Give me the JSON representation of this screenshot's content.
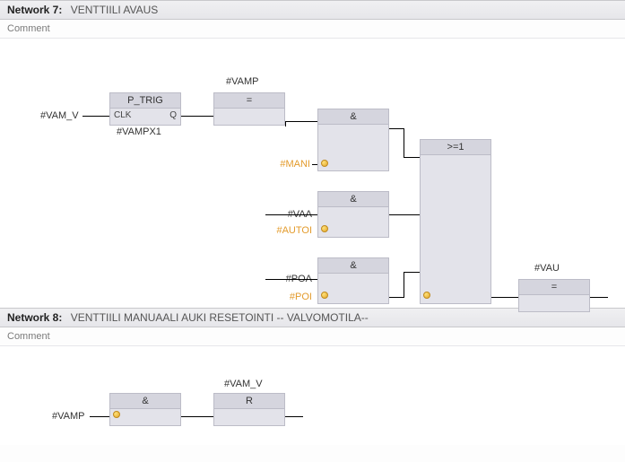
{
  "network7": {
    "label": "Network 7:",
    "title": "VENTTIILI AVAUS",
    "comment": "Comment",
    "signals": {
      "vam_v": "#VAM_V",
      "vampx1": "#VAMPX1",
      "vamp": "#VAMP",
      "mani": "#MANI",
      "vaa": "#VAA",
      "autoi": "#AUTOI",
      "poa": "#POA",
      "poi": "#POI",
      "vau": "#VAU"
    },
    "blocks": {
      "ptrig": {
        "title": "P_TRIG",
        "clk": "CLK",
        "q": "Q"
      },
      "eq": "=",
      "and1": "&",
      "and2": "&",
      "and3": "&",
      "or": ">=1",
      "out_eq": "=",
      "and_n8": "&",
      "r_n8": "R"
    }
  },
  "network8": {
    "label": "Network 8:",
    "title": "VENTTIILI MANUAALI AUKI RESETOINTI -- VALVOMOTILA--",
    "comment": "Comment",
    "signals": {
      "vamp": "#VAMP",
      "vam_v": "#VAM_V"
    }
  }
}
